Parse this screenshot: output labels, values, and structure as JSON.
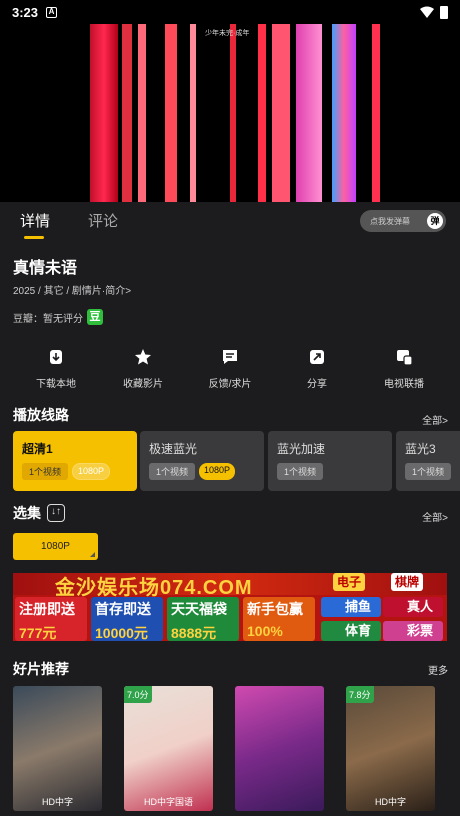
{
  "status": {
    "time": "3:23",
    "a_icon": "A"
  },
  "video": {
    "caption": "少年未完·成年"
  },
  "tabs": [
    {
      "label": "详情"
    },
    {
      "label": "评论"
    }
  ],
  "danmu": {
    "placeholder": "点我发弹幕",
    "icon_text": "弹"
  },
  "movie": {
    "title": "真情未语",
    "meta": "2025 / 其它 / 剧情片·简介>",
    "douban_label": "豆瓣：暂无评分",
    "douban_icon_text": "豆"
  },
  "actions": [
    {
      "label": "下载本地",
      "icon": "download-icon"
    },
    {
      "label": "收藏影片",
      "icon": "star-icon"
    },
    {
      "label": "反馈/求片",
      "icon": "feedback-icon"
    },
    {
      "label": "分享",
      "icon": "share-icon"
    },
    {
      "label": "电视联播",
      "icon": "tv-cast-icon"
    }
  ],
  "routes_section": {
    "title": "播放线路",
    "more": "全部>"
  },
  "routes": [
    {
      "name": "超清1",
      "count": "1个视频",
      "quality": "1080P"
    },
    {
      "name": "极速蓝光",
      "count": "1个视频",
      "quality": "1080P"
    },
    {
      "name": "蓝光加速",
      "count": "1个视频",
      "quality": ""
    },
    {
      "name": "蓝光3",
      "count": "1个视频",
      "quality": ""
    }
  ],
  "episodes_section": {
    "title": "选集",
    "more": "全部>",
    "sort_icon": "↓↑"
  },
  "episodes": [
    {
      "label": "1080P"
    }
  ],
  "ad": {
    "title": "金沙娱乐场074.COM",
    "tags": [
      "电子",
      "棋牌",
      "捕鱼",
      "真人",
      "体育",
      "彩票"
    ],
    "cells": [
      {
        "t": "注册即送",
        "n": "777元"
      },
      {
        "t": "首存即送",
        "n": "10000元"
      },
      {
        "t": "天天福袋",
        "n": "8888元"
      },
      {
        "t": "新手包赢",
        "n": "100%"
      }
    ]
  },
  "recs_section": {
    "title": "好片推荐",
    "more": "更多"
  },
  "recs": [
    {
      "label": "HD中字",
      "score": ""
    },
    {
      "label": "HD中字国语",
      "score": "7.0分"
    },
    {
      "label": "",
      "score": ""
    },
    {
      "label": "HD中字",
      "score": "7.8分"
    }
  ],
  "colors": {
    "accent": "#f5c000",
    "background": "#1c1c1e",
    "douban": "#2fbf3c"
  }
}
